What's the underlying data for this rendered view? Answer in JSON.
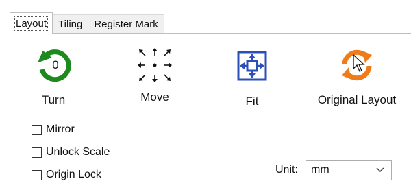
{
  "tabs": [
    {
      "label": "Layout",
      "active": true
    },
    {
      "label": "Tiling",
      "active": false
    },
    {
      "label": "Register Mark",
      "active": false
    }
  ],
  "tools": {
    "turn": {
      "label": "Turn",
      "icon": "rotate-icon",
      "value": "0",
      "color": "#1e8a1e"
    },
    "move": {
      "label": "Move",
      "icon": "move-arrows-icon"
    },
    "fit": {
      "label": "Fit",
      "icon": "fit-icon",
      "color": "#2b4fb8"
    },
    "original_layout": {
      "label": "Original Layout",
      "icon": "reset-layout-icon",
      "color": "#f07c19"
    }
  },
  "options": {
    "mirror": {
      "label": "Mirror",
      "checked": false
    },
    "unlock_scale": {
      "label": "Unlock Scale",
      "checked": false
    },
    "origin_lock": {
      "label": "Origin Lock",
      "checked": false
    }
  },
  "unit": {
    "label": "Unit:",
    "value": "mm"
  }
}
